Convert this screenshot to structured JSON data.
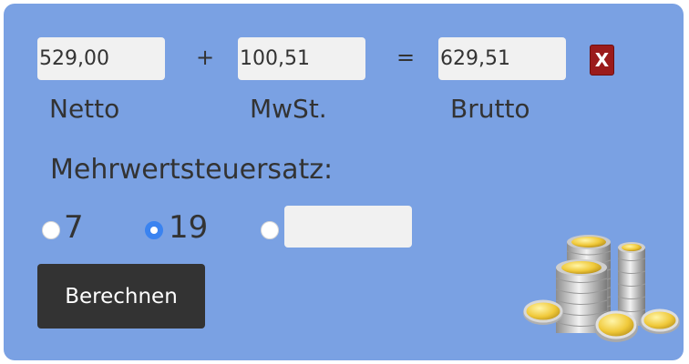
{
  "calculator": {
    "netto_value": "529,00",
    "mwst_value": "100,51",
    "brutto_value": "629,51",
    "plus_symbol": "+",
    "equals_symbol": "=",
    "clear_label": "X",
    "labels": {
      "netto": "Netto",
      "mwst": "MwSt.",
      "brutto": "Brutto"
    }
  },
  "rate": {
    "section_label": "Mehrwertsteuersatz:",
    "options": [
      {
        "label": "7",
        "checked": false
      },
      {
        "label": "19",
        "checked": true
      },
      {
        "label": "",
        "checked": false
      }
    ],
    "custom_value": ""
  },
  "actions": {
    "calculate_label": "Berechnen"
  },
  "colors": {
    "panel_bg": "#7aa1e3",
    "clear_button": "#9b1b1b",
    "calc_button": "#333333",
    "radio_checked": "#3a83f0"
  },
  "decoration": {
    "image_icon": "coin-stack-icon"
  }
}
